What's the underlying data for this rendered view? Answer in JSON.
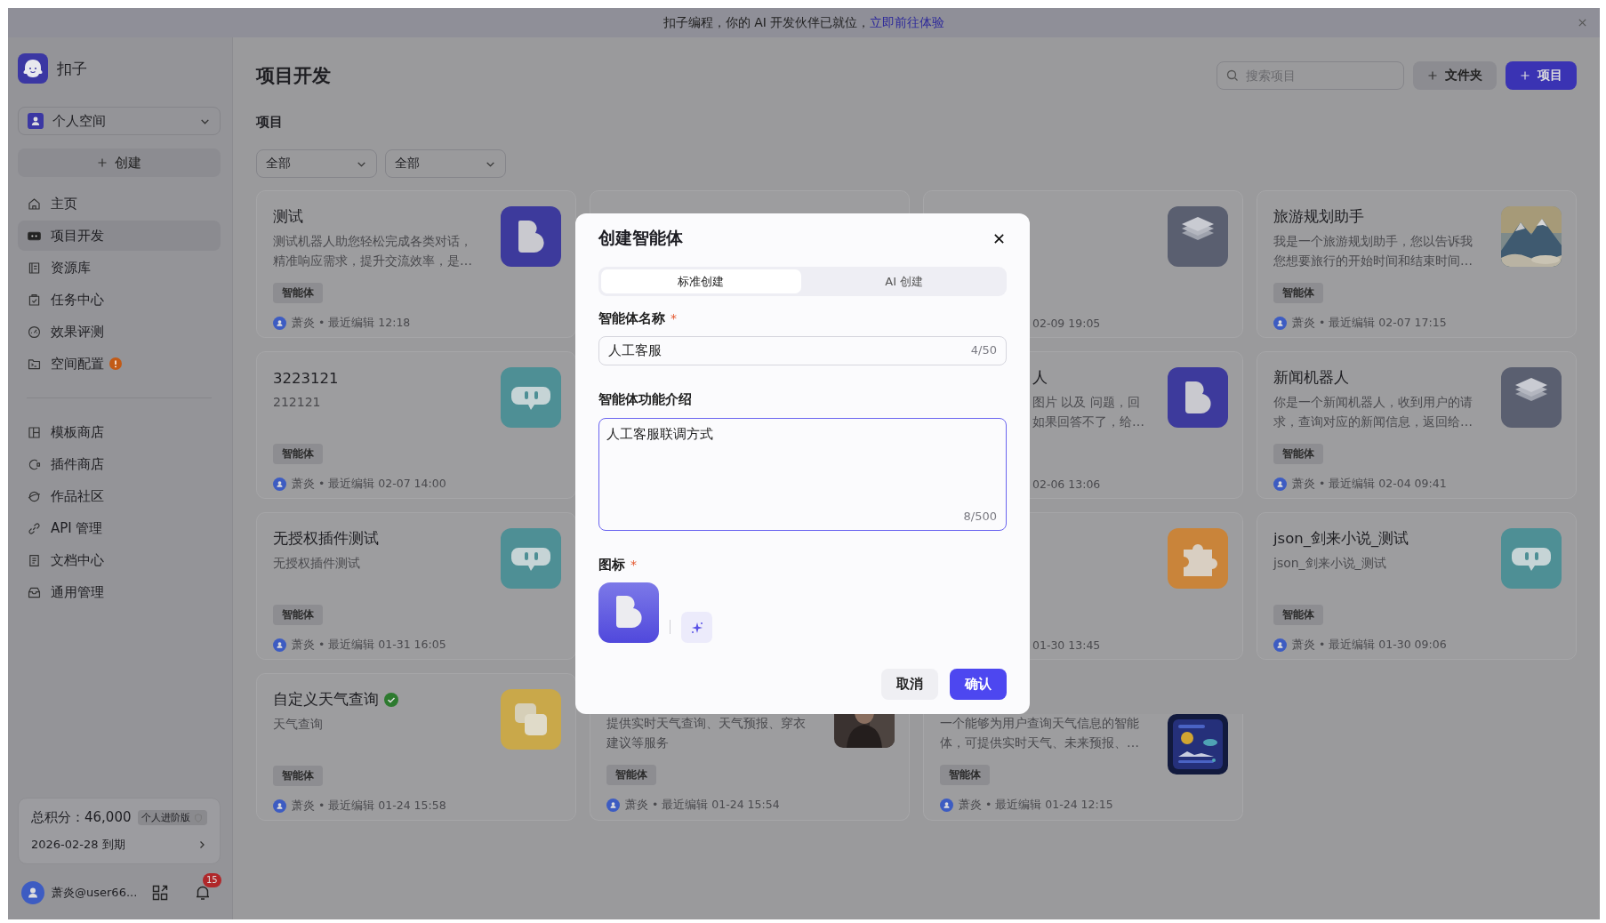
{
  "banner": {
    "text": "扣子编程，你的 AI 开发伙伴已就位，",
    "link": "立即前往体验"
  },
  "sidebar": {
    "brand": "扣子",
    "space": "个人空间",
    "create": "创建",
    "nav": [
      {
        "label": "主页",
        "selected": false,
        "alert": false
      },
      {
        "label": "项目开发",
        "selected": true,
        "alert": false
      },
      {
        "label": "资源库",
        "selected": false,
        "alert": false
      },
      {
        "label": "任务中心",
        "selected": false,
        "alert": false
      },
      {
        "label": "效果评测",
        "selected": false,
        "alert": false
      },
      {
        "label": "空间配置",
        "selected": false,
        "alert": true
      }
    ],
    "nav2": [
      {
        "label": "模板商店",
        "selected": false,
        "alert": false
      },
      {
        "label": "插件商店",
        "selected": false,
        "alert": false
      },
      {
        "label": "作品社区",
        "selected": false,
        "alert": false
      },
      {
        "label": "API 管理",
        "selected": false,
        "alert": false
      },
      {
        "label": "文档中心",
        "selected": false,
        "alert": false
      },
      {
        "label": "通用管理",
        "selected": false,
        "alert": false
      }
    ],
    "points": {
      "label": "总积分：46,000",
      "plan": "个人进阶版",
      "expiry": "2026-02-28 到期"
    },
    "user": {
      "name": "萧炎@user66...",
      "notifications": "15"
    }
  },
  "header": {
    "title": "项目开发",
    "search_placeholder": "搜索项目",
    "folder_button": "文件夹",
    "project_button": "项目"
  },
  "section": "项目",
  "filters": [
    "全部",
    "全部"
  ],
  "cards": [
    {
      "kind": "full",
      "title": "测试",
      "verified": false,
      "desc_lines": [
        "测试机器人助您轻松完成各类对话，",
        "精准响应需求，提升交流效率，是…"
      ],
      "tag": "智能体",
      "meta": "萧炎 • 最近编辑 12:18",
      "icon": {
        "kind": "blob",
        "color": "#3d3a9c"
      }
    },
    {
      "kind": "hidden"
    },
    {
      "kind": "fragment",
      "meta": "02-09 19:05",
      "icon": {
        "kind": "layers",
        "color": "#5a5f70"
      }
    },
    {
      "kind": "full",
      "title": "旅游规划助手",
      "verified": false,
      "desc_lines": [
        "我是一个旅游规划助手，您以告诉我",
        "您想要旅行的开始时间和结束时间…"
      ],
      "tag": "智能体",
      "meta": "萧炎 • 最近编辑 02-07 17:15"
    },
    {
      "kind": "full",
      "title": "3223121",
      "verified": false,
      "desc_lines": [
        "212121"
      ],
      "tag": "智能体",
      "meta": "萧炎 • 最近编辑 02-07 14:00",
      "icon": {
        "kind": "chat",
        "color": "#4e8f95"
      }
    },
    {
      "kind": "fragment",
      "title": "人",
      "desc_lines": [
        "图片 以及 问题，回",
        "如果回答不了，给…"
      ],
      "meta": "02-06 13:06",
      "icon": {
        "kind": "blob",
        "color": "#3d3a9c"
      }
    },
    {
      "kind": "full",
      "title": "新闻机器人",
      "verified": false,
      "desc_lines": [
        "你是一个新闻机器人，收到用户的请",
        "求，查询对应的新闻信息，返回给…"
      ],
      "tag": "智能体",
      "meta": "萧炎 • 最近编辑 02-04 09:41",
      "icon": {
        "kind": "layers",
        "color": "#5a5f70"
      }
    },
    {
      "kind": "full",
      "title": "无授权插件测试",
      "verified": false,
      "desc_lines": [
        "无授权插件测试"
      ],
      "tag": "智能体",
      "meta": "萧炎 • 最近编辑 01-31 16:05",
      "icon": {
        "kind": "chat",
        "color": "#4e8f95"
      }
    },
    {
      "kind": "fragment",
      "meta": "01-30 13:45",
      "icon": {
        "kind": "puzzle",
        "color": "#c9843a"
      }
    },
    {
      "kind": "full",
      "title": "json_剑来小说_测试",
      "verified": false,
      "desc_lines": [
        "json_剑来小说_测试"
      ],
      "tag": "智能体",
      "meta": "萧炎 • 最近编辑 01-30 09:06",
      "icon": {
        "kind": "chat",
        "color": "#4e8f95"
      }
    },
    {
      "kind": "full",
      "title": "自定义天气查询",
      "verified": true,
      "desc_lines": [
        "天气查询"
      ],
      "tag": "智能体",
      "meta": "萧炎 • 最近编辑 01-24 15:58",
      "icon": {
        "kind": "squares",
        "color": "#c9a84a"
      }
    },
    {
      "kind": "lower",
      "desc_lines": [
        "提供实时天气查询、天气预报、穿衣",
        "建议等服务"
      ],
      "tag": "智能体",
      "meta": "萧炎 • 最近编辑 01-24 15:54"
    },
    {
      "kind": "lower",
      "desc_lines": [
        "一个能够为用户查询天气信息的智能",
        "体，可提供实时天气、未来预报、…"
      ],
      "tag": "智能体",
      "meta": "萧炎 • 最近编辑 01-24 12:15"
    }
  ],
  "dialog": {
    "title": "创建智能体",
    "tabs": [
      {
        "label": "标准创建",
        "selected": true
      },
      {
        "label": "AI 创建",
        "selected": false
      }
    ],
    "name_label": "智能体名称",
    "name_required": "*",
    "name_value": "人工客服",
    "name_count": "4/50",
    "desc_label": "智能体功能介绍",
    "desc_value": "人工客服联调方式",
    "desc_count": "8/500",
    "desc_focused": true,
    "icon_label": "图标",
    "icon_required": "*",
    "cancel": "取消",
    "confirm": "确认"
  }
}
